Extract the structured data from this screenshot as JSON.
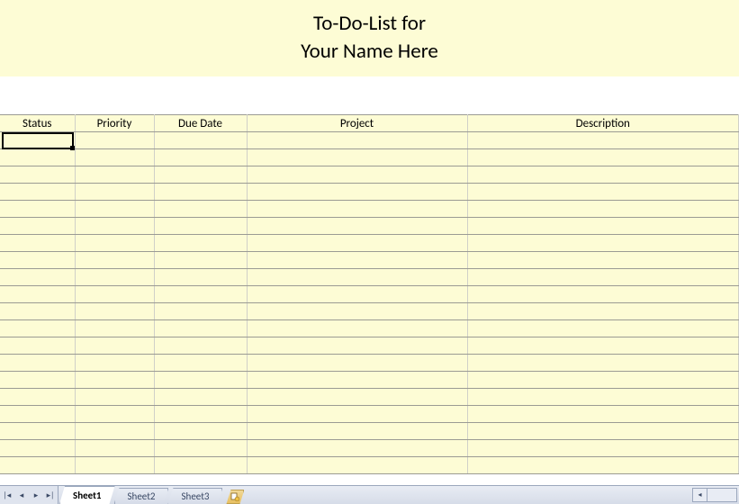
{
  "title": {
    "line1": "To-Do-List for",
    "line2": "Your Name Here"
  },
  "columns": {
    "status": "Status",
    "priority": "Priority",
    "dueDate": "Due Date",
    "project": "Project",
    "description": "Description"
  },
  "rows": [
    {
      "status": "",
      "priority": "",
      "dueDate": "",
      "project": "",
      "description": ""
    },
    {
      "status": "",
      "priority": "",
      "dueDate": "",
      "project": "",
      "description": ""
    },
    {
      "status": "",
      "priority": "",
      "dueDate": "",
      "project": "",
      "description": ""
    },
    {
      "status": "",
      "priority": "",
      "dueDate": "",
      "project": "",
      "description": ""
    },
    {
      "status": "",
      "priority": "",
      "dueDate": "",
      "project": "",
      "description": ""
    },
    {
      "status": "",
      "priority": "",
      "dueDate": "",
      "project": "",
      "description": ""
    },
    {
      "status": "",
      "priority": "",
      "dueDate": "",
      "project": "",
      "description": ""
    },
    {
      "status": "",
      "priority": "",
      "dueDate": "",
      "project": "",
      "description": ""
    },
    {
      "status": "",
      "priority": "",
      "dueDate": "",
      "project": "",
      "description": ""
    },
    {
      "status": "",
      "priority": "",
      "dueDate": "",
      "project": "",
      "description": ""
    },
    {
      "status": "",
      "priority": "",
      "dueDate": "",
      "project": "",
      "description": ""
    },
    {
      "status": "",
      "priority": "",
      "dueDate": "",
      "project": "",
      "description": ""
    },
    {
      "status": "",
      "priority": "",
      "dueDate": "",
      "project": "",
      "description": ""
    },
    {
      "status": "",
      "priority": "",
      "dueDate": "",
      "project": "",
      "description": ""
    },
    {
      "status": "",
      "priority": "",
      "dueDate": "",
      "project": "",
      "description": ""
    },
    {
      "status": "",
      "priority": "",
      "dueDate": "",
      "project": "",
      "description": ""
    },
    {
      "status": "",
      "priority": "",
      "dueDate": "",
      "project": "",
      "description": ""
    },
    {
      "status": "",
      "priority": "",
      "dueDate": "",
      "project": "",
      "description": ""
    },
    {
      "status": "",
      "priority": "",
      "dueDate": "",
      "project": "",
      "description": ""
    },
    {
      "status": "",
      "priority": "",
      "dueDate": "",
      "project": "",
      "description": ""
    }
  ],
  "tabs": {
    "sheet1": "Sheet1",
    "sheet2": "Sheet2",
    "sheet3": "Sheet3"
  },
  "nav": {
    "first": "|◂",
    "prev": "◂",
    "next": "▸",
    "last": "▸|"
  }
}
